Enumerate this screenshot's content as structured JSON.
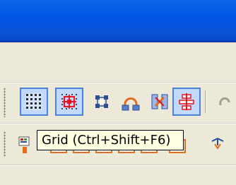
{
  "window": {
    "title": ""
  },
  "toolbar_row_1": {
    "buttons": [
      {
        "icon": "grid-icon",
        "state": "pressed"
      },
      {
        "icon": "snap-to-grid-icon",
        "state": "pressed"
      },
      {
        "icon": "select-node-icon",
        "state": "normal"
      },
      {
        "icon": "connector-icon",
        "state": "normal"
      },
      {
        "icon": "reconnect-icon",
        "state": "normal"
      },
      {
        "icon": "align-icon",
        "state": "pressed"
      }
    ]
  },
  "toolbar_row_2": {
    "icons": [
      "properties-icon",
      "shape-icon",
      "shape-icon",
      "shape-icon",
      "shape-icon",
      "shape-icon",
      "shape-icon",
      "link-icon"
    ]
  },
  "tooltip": {
    "text": "Grid (Ctrl+Shift+F6)"
  },
  "colors": {
    "titlebar": "#0054e3",
    "toolbar_bg": "#ece9d8",
    "pressed_bg": "#c2d9ff",
    "pressed_border": "#4a83d9",
    "tooltip_bg": "#ffffe1",
    "icon_red": "#e8141b",
    "icon_orange": "#e36b1a"
  }
}
